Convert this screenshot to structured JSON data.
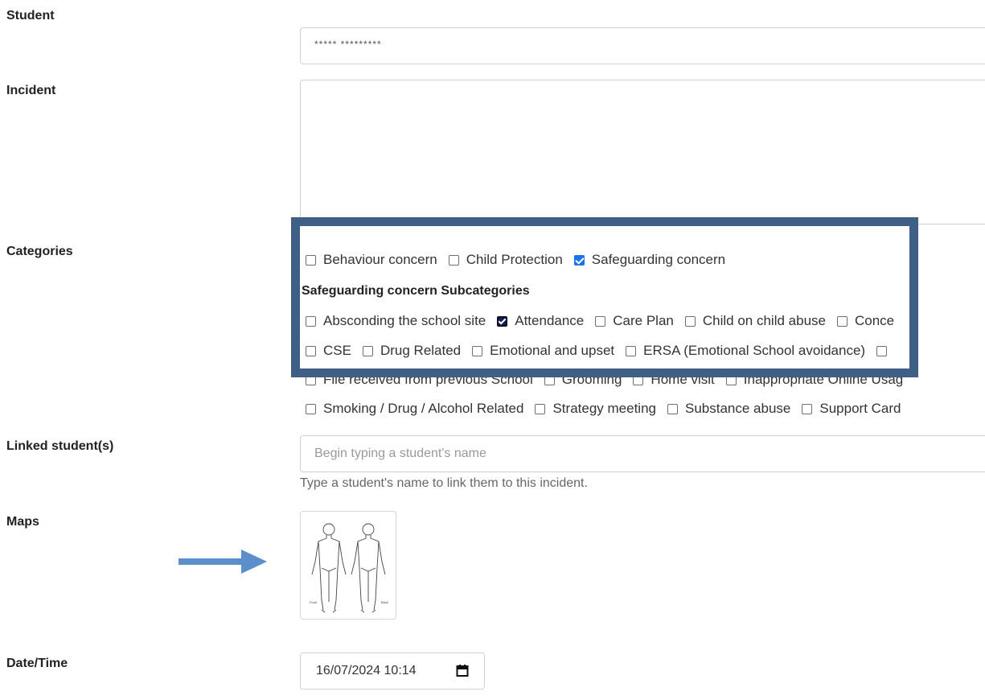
{
  "labels": {
    "student": "Student",
    "incident": "Incident",
    "categories": "Categories",
    "linked": "Linked student(s)",
    "maps": "Maps",
    "datetime": "Date/Time"
  },
  "student": {
    "value": "***** *********"
  },
  "incident": {
    "value": ""
  },
  "categories": [
    {
      "label": "Behaviour concern",
      "checked": false
    },
    {
      "label": "Child Protection",
      "checked": false
    },
    {
      "label": "Safeguarding concern",
      "checked": true
    }
  ],
  "subcategories": {
    "heading": "Safeguarding concern Subcategories",
    "row1": [
      "Absconding the school site",
      "Attendance",
      "Care Plan",
      "Child on child abuse",
      "Conce"
    ],
    "row2": [
      "CSE",
      "Drug Related",
      "Emotional and upset",
      "ERSA (Emotional School avoidance)",
      ""
    ],
    "row3": [
      "File received from previous School",
      "Grooming",
      "Home visit",
      "Inappropriate Online Usag"
    ],
    "row4": [
      "Smoking / Drug / Alcohol Related",
      "Strategy meeting",
      "Substance abuse",
      "Support Card"
    ]
  },
  "linked": {
    "placeholder": "Begin typing a student's name",
    "hint": "Type a student's name to link them to this incident."
  },
  "maps": {
    "front_label": "Front",
    "back_label": "Back",
    "icon": "body-map-icon"
  },
  "datetime": {
    "value": "16/07/2024  10:14",
    "icon": "calendar-icon"
  },
  "colors": {
    "accent": "#1a73e8",
    "highlight": "#3f5f86",
    "arrow": "#5b8fcc"
  }
}
